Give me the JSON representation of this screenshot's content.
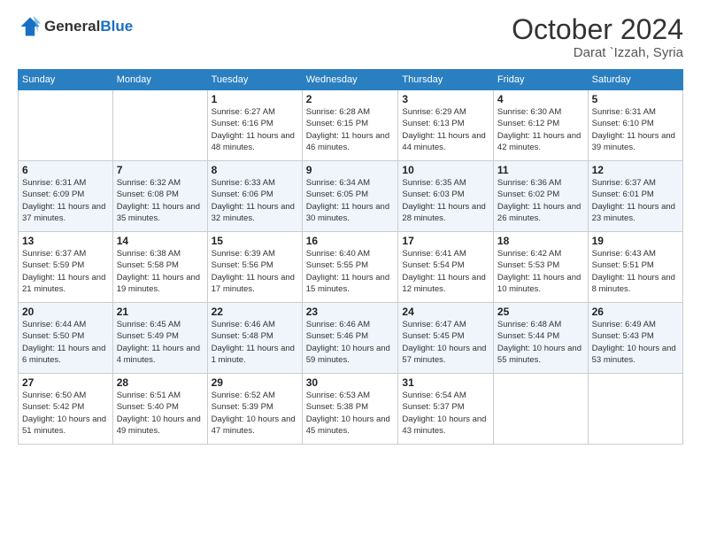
{
  "logo": {
    "line1": "General",
    "line2": "Blue"
  },
  "title": "October 2024",
  "location": "Darat `Izzah, Syria",
  "weekdays": [
    "Sunday",
    "Monday",
    "Tuesday",
    "Wednesday",
    "Thursday",
    "Friday",
    "Saturday"
  ],
  "weeks": [
    [
      {
        "day": "",
        "info": ""
      },
      {
        "day": "",
        "info": ""
      },
      {
        "day": "1",
        "info": "Sunrise: 6:27 AM\nSunset: 6:16 PM\nDaylight: 11 hours and 48 minutes."
      },
      {
        "day": "2",
        "info": "Sunrise: 6:28 AM\nSunset: 6:15 PM\nDaylight: 11 hours and 46 minutes."
      },
      {
        "day": "3",
        "info": "Sunrise: 6:29 AM\nSunset: 6:13 PM\nDaylight: 11 hours and 44 minutes."
      },
      {
        "day": "4",
        "info": "Sunrise: 6:30 AM\nSunset: 6:12 PM\nDaylight: 11 hours and 42 minutes."
      },
      {
        "day": "5",
        "info": "Sunrise: 6:31 AM\nSunset: 6:10 PM\nDaylight: 11 hours and 39 minutes."
      }
    ],
    [
      {
        "day": "6",
        "info": "Sunrise: 6:31 AM\nSunset: 6:09 PM\nDaylight: 11 hours and 37 minutes."
      },
      {
        "day": "7",
        "info": "Sunrise: 6:32 AM\nSunset: 6:08 PM\nDaylight: 11 hours and 35 minutes."
      },
      {
        "day": "8",
        "info": "Sunrise: 6:33 AM\nSunset: 6:06 PM\nDaylight: 11 hours and 32 minutes."
      },
      {
        "day": "9",
        "info": "Sunrise: 6:34 AM\nSunset: 6:05 PM\nDaylight: 11 hours and 30 minutes."
      },
      {
        "day": "10",
        "info": "Sunrise: 6:35 AM\nSunset: 6:03 PM\nDaylight: 11 hours and 28 minutes."
      },
      {
        "day": "11",
        "info": "Sunrise: 6:36 AM\nSunset: 6:02 PM\nDaylight: 11 hours and 26 minutes."
      },
      {
        "day": "12",
        "info": "Sunrise: 6:37 AM\nSunset: 6:01 PM\nDaylight: 11 hours and 23 minutes."
      }
    ],
    [
      {
        "day": "13",
        "info": "Sunrise: 6:37 AM\nSunset: 5:59 PM\nDaylight: 11 hours and 21 minutes."
      },
      {
        "day": "14",
        "info": "Sunrise: 6:38 AM\nSunset: 5:58 PM\nDaylight: 11 hours and 19 minutes."
      },
      {
        "day": "15",
        "info": "Sunrise: 6:39 AM\nSunset: 5:56 PM\nDaylight: 11 hours and 17 minutes."
      },
      {
        "day": "16",
        "info": "Sunrise: 6:40 AM\nSunset: 5:55 PM\nDaylight: 11 hours and 15 minutes."
      },
      {
        "day": "17",
        "info": "Sunrise: 6:41 AM\nSunset: 5:54 PM\nDaylight: 11 hours and 12 minutes."
      },
      {
        "day": "18",
        "info": "Sunrise: 6:42 AM\nSunset: 5:53 PM\nDaylight: 11 hours and 10 minutes."
      },
      {
        "day": "19",
        "info": "Sunrise: 6:43 AM\nSunset: 5:51 PM\nDaylight: 11 hours and 8 minutes."
      }
    ],
    [
      {
        "day": "20",
        "info": "Sunrise: 6:44 AM\nSunset: 5:50 PM\nDaylight: 11 hours and 6 minutes."
      },
      {
        "day": "21",
        "info": "Sunrise: 6:45 AM\nSunset: 5:49 PM\nDaylight: 11 hours and 4 minutes."
      },
      {
        "day": "22",
        "info": "Sunrise: 6:46 AM\nSunset: 5:48 PM\nDaylight: 11 hours and 1 minute."
      },
      {
        "day": "23",
        "info": "Sunrise: 6:46 AM\nSunset: 5:46 PM\nDaylight: 10 hours and 59 minutes."
      },
      {
        "day": "24",
        "info": "Sunrise: 6:47 AM\nSunset: 5:45 PM\nDaylight: 10 hours and 57 minutes."
      },
      {
        "day": "25",
        "info": "Sunrise: 6:48 AM\nSunset: 5:44 PM\nDaylight: 10 hours and 55 minutes."
      },
      {
        "day": "26",
        "info": "Sunrise: 6:49 AM\nSunset: 5:43 PM\nDaylight: 10 hours and 53 minutes."
      }
    ],
    [
      {
        "day": "27",
        "info": "Sunrise: 6:50 AM\nSunset: 5:42 PM\nDaylight: 10 hours and 51 minutes."
      },
      {
        "day": "28",
        "info": "Sunrise: 6:51 AM\nSunset: 5:40 PM\nDaylight: 10 hours and 49 minutes."
      },
      {
        "day": "29",
        "info": "Sunrise: 6:52 AM\nSunset: 5:39 PM\nDaylight: 10 hours and 47 minutes."
      },
      {
        "day": "30",
        "info": "Sunrise: 6:53 AM\nSunset: 5:38 PM\nDaylight: 10 hours and 45 minutes."
      },
      {
        "day": "31",
        "info": "Sunrise: 6:54 AM\nSunset: 5:37 PM\nDaylight: 10 hours and 43 minutes."
      },
      {
        "day": "",
        "info": ""
      },
      {
        "day": "",
        "info": ""
      }
    ]
  ]
}
